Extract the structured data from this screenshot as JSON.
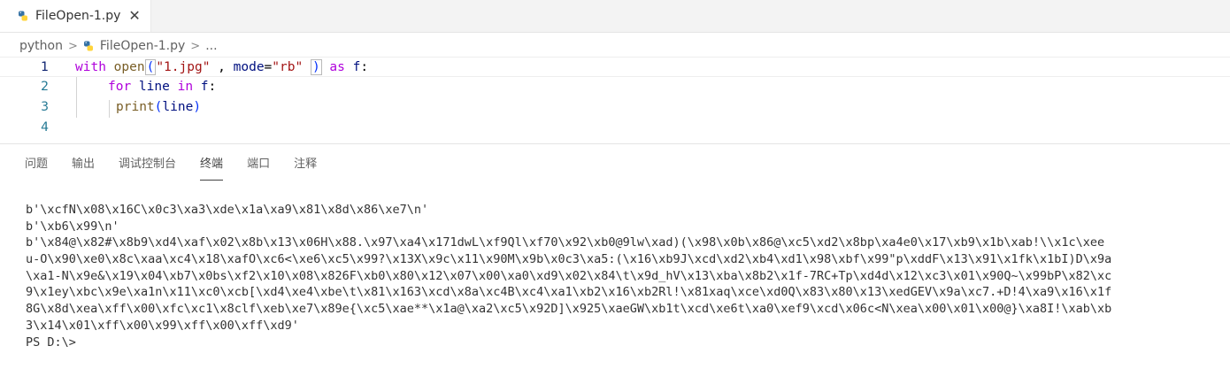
{
  "editor_tab": {
    "title": "FileOpen-1.py",
    "close_glyph": "✕"
  },
  "breadcrumb": {
    "folder": "python",
    "file": "FileOpen-1.py",
    "more": "..."
  },
  "code": {
    "line_numbers": [
      "1",
      "2",
      "3",
      "4"
    ],
    "l1": {
      "kw_with": "with",
      "fn_open": "open",
      "lparen": "(",
      "str_file": "\"1.jpg\"",
      "sep": " , ",
      "param": "mode",
      "eq": "=",
      "str_mode": "\"rb\"",
      "space": " ",
      "rparen": ")",
      "kw_as": " as ",
      "var_f": "f",
      "colon": ":"
    },
    "l2": {
      "kw_for": "for",
      "var_line": " line ",
      "kw_in": "in",
      "var_f": " f",
      "colon": ":"
    },
    "l3": {
      "fn_print": "print",
      "lparen": "(",
      "var_line": "line",
      "rparen": ")"
    }
  },
  "panel_tabs": [
    "问题",
    "输出",
    "调试控制台",
    "终端",
    "端口",
    "注释"
  ],
  "active_panel_tab": "终端",
  "terminal_lines": [
    "b'\\xcfN\\x08\\x16C\\x0c3\\xa3\\xde\\x1a\\xa9\\x81\\x8d\\x86\\xe7\\n'",
    "b'\\xb6\\x99\\n'",
    "b'\\x84@\\x82#\\x8b9\\xd4\\xaf\\x02\\x8b\\x13\\x06H\\x88.\\x97\\xa4\\x171dwL\\xf9Ql\\xf70\\x92\\xb0@9lw\\xad)(\\x98\\x0b\\x86@\\xc5\\xd2\\x8bp\\xa4e0\\x17\\xb9\\x1b\\xab!\\\\x1c\\xee",
    "u-O\\x90\\xe0\\x8c\\xaa\\xc4\\x18\\xafO\\xc6<\\xe6\\xc5\\x99?\\x13X\\x9c\\x11\\x90M\\x9b\\x0c3\\xa5:(\\x16\\xb9J\\xcd\\xd2\\xb4\\xd1\\x98\\xbf\\x99\"p\\xddF\\x13\\x91\\x1fk\\x1bI)D\\x9a",
    "\\xa1-N\\x9e&\\x19\\x04\\xb7\\x0bs\\xf2\\x10\\x08\\x826F\\xb0\\x80\\x12\\x07\\x00\\xa0\\xd9\\x02\\x84\\t\\x9d_hV\\x13\\xba\\x8b2\\x1f-7RC+Tp\\xd4d\\x12\\xc3\\x01\\x90Q~\\x99bP\\x82\\xc",
    "9\\x1ey\\xbc\\x9e\\xa1n\\x11\\xc0\\xcb[\\xd4\\xe4\\xbe\\t\\x81\\x163\\xcd\\x8a\\xc4B\\xc4\\xa1\\xb2\\x16\\xb2Rl!\\x81xaq\\xce\\xd0Q\\x83\\x80\\x13\\xedGEV\\x9a\\xc7.+D!4\\xa9\\x16\\x1f",
    "8G\\x8d\\xea\\xff\\x00\\xfc\\xc1\\x8clf\\xeb\\xe7\\x89e{\\xc5\\xae**\\x1a@\\xa2\\xc5\\x92D]\\x925\\xaeGW\\xb1t\\xcd\\xe6t\\xa0\\xef9\\xcd\\x06c<N\\xea\\x00\\x01\\x00@}\\xa8I!\\xab\\xb",
    "3\\x14\\x01\\xff\\x00\\x99\\xff\\x00\\xff\\xd9'",
    "PS D:\\>"
  ]
}
